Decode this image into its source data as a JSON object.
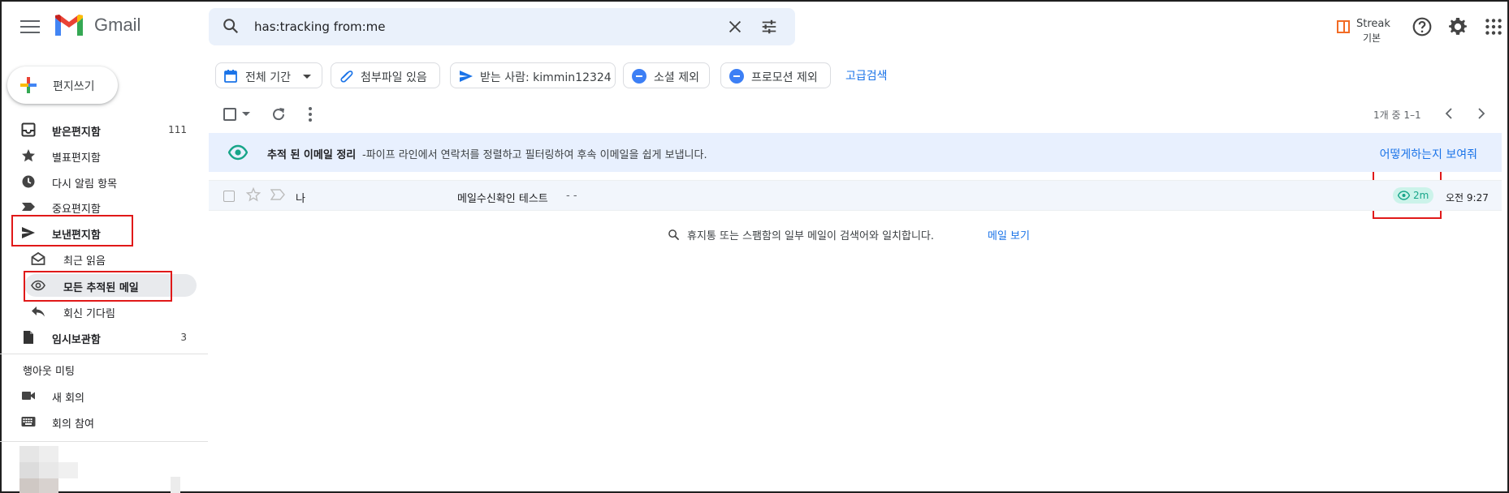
{
  "header": {
    "app_name": "Gmail",
    "search_value": "has:tracking from:me",
    "streak_label": "Streak",
    "streak_sub": "기본"
  },
  "colors": {
    "accent_blue": "#1a73e8",
    "annotation_red": "#e01919",
    "tracking_green": "#17a589",
    "banner_bg": "#e8f0fe"
  },
  "sidebar": {
    "compose_label": "편지쓰기",
    "items": [
      {
        "label": "받은편지함",
        "count": "111",
        "icon": "inbox-icon"
      },
      {
        "label": "별표편지함",
        "icon": "star-icon"
      },
      {
        "label": "다시 알림 항목",
        "icon": "clock-icon"
      },
      {
        "label": "중요편지함",
        "icon": "important-icon"
      },
      {
        "label": "보낸편지함",
        "icon": "send-icon"
      },
      {
        "label": "최근 읽음",
        "icon": "open-mail-icon"
      },
      {
        "label": "모든 추적된 메일",
        "icon": "eye-icon"
      },
      {
        "label": "회신 기다림",
        "icon": "reply-icon"
      },
      {
        "label": "임시보관함",
        "count": "3",
        "icon": "draft-icon"
      }
    ],
    "meet_title": "행아웃 미팅",
    "meet_items": [
      {
        "label": "새 회의",
        "icon": "video-icon"
      },
      {
        "label": "회의 참여",
        "icon": "keyboard-icon"
      }
    ]
  },
  "chips": [
    {
      "label": "전체 기간"
    },
    {
      "label": "첨부파일 있음"
    },
    {
      "label": "받는 사람: kimmin12324"
    },
    {
      "label": "소셜 제외"
    },
    {
      "label": "프로모션 제외"
    }
  ],
  "advanced_search": "고급검색",
  "pager": "1개 중 1–1",
  "banner": {
    "title": "추적 된 이메일 정리",
    "text": "-파이프 라인에서 연락처를 정렬하고 필터링하여 후속 이메일을 쉽게 보냅니다.",
    "link": "어떻게하는지 보여줘"
  },
  "email": {
    "sender": "나",
    "subject": "메일수신확인 테스트",
    "snippet": "- -",
    "tracking": "2m",
    "time": "오전 9:27"
  },
  "notice": {
    "text": "휴지통 또는 스팸함의 일부 메일이 검색어와 일치합니다.",
    "link": "메일 보기"
  }
}
